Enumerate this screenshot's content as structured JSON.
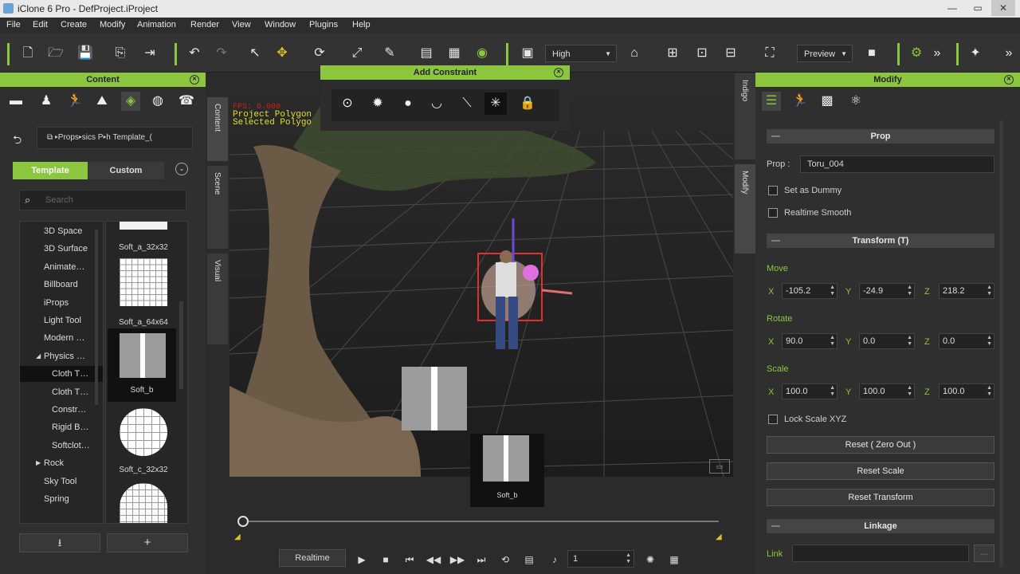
{
  "window": {
    "title": "iClone 6 Pro - DefProject.iProject"
  },
  "menu": [
    "File",
    "Edit",
    "Create",
    "Modify",
    "Animation",
    "Render",
    "View",
    "Window",
    "Plugins",
    "Help"
  ],
  "toolbar": {
    "quality": "High",
    "preview": "Preview"
  },
  "content": {
    "title": "Content",
    "breadcrumb": "▸Props▸sics P▸h Template_(",
    "tab_template": "Template",
    "tab_custom": "Custom",
    "search_placeholder": "Search",
    "tree": [
      {
        "label": "3D Space",
        "indent": 1
      },
      {
        "label": "3D Surface",
        "indent": 1
      },
      {
        "label": "Animate…",
        "indent": 1
      },
      {
        "label": "Billboard",
        "indent": 1
      },
      {
        "label": "iProps",
        "indent": 1
      },
      {
        "label": "Light Tool",
        "indent": 1
      },
      {
        "label": "Modern …",
        "indent": 1
      },
      {
        "label": "Physics …",
        "indent": 1
      },
      {
        "label": "Cloth T…",
        "indent": 2
      },
      {
        "label": "Cloth T…",
        "indent": 2
      },
      {
        "label": "Constr…",
        "indent": 2
      },
      {
        "label": "Rigid B…",
        "indent": 2
      },
      {
        "label": "Softclot…",
        "indent": 2
      },
      {
        "label": "Rock",
        "indent": 0
      },
      {
        "label": "Sky Tool",
        "indent": 1
      },
      {
        "label": "Spring",
        "indent": 1
      }
    ],
    "thumbs": [
      "Soft_a_32x32",
      "Soft_a_64x64",
      "Soft_b",
      "Soft_c_32x32"
    ]
  },
  "side_tabs": {
    "left": [
      "Content",
      "Scene",
      "Visual"
    ],
    "right": [
      "Indigo",
      "Modify"
    ]
  },
  "viewport": {
    "overlay_line1": "Project Polygon",
    "overlay_line2": "Selected Polygo",
    "overlay_red": "FPS: 0.000",
    "drag_label": "Soft_b"
  },
  "constraint": {
    "title": "Add Constraint"
  },
  "modify": {
    "title": "Modify",
    "prop_section": "Prop",
    "prop_label": "Prop :",
    "prop_name": "Toru_004",
    "set_dummy": "Set as Dummy",
    "realtime_smooth": "Realtime Smooth",
    "transform_section": "Transform  (T)",
    "move_label": "Move",
    "move": {
      "x": "-105.2",
      "y": "-24.9",
      "z": "218.2"
    },
    "rotate_label": "Rotate",
    "rotate": {
      "x": "90.0",
      "y": "0.0",
      "z": "0.0"
    },
    "scale_label": "Scale",
    "scale": {
      "x": "100.0",
      "y": "100.0",
      "z": "100.0"
    },
    "axis_x": "X",
    "axis_y": "Y",
    "axis_z": "Z",
    "lock_scale": "Lock Scale XYZ",
    "reset_zero": "Reset ( Zero Out )",
    "reset_scale": "Reset Scale",
    "reset_transform": "Reset Transform",
    "linkage_section": "Linkage",
    "link_label": "Link",
    "link_btn": "..."
  },
  "timeline": {
    "realtime": "Realtime",
    "frame": "1"
  }
}
